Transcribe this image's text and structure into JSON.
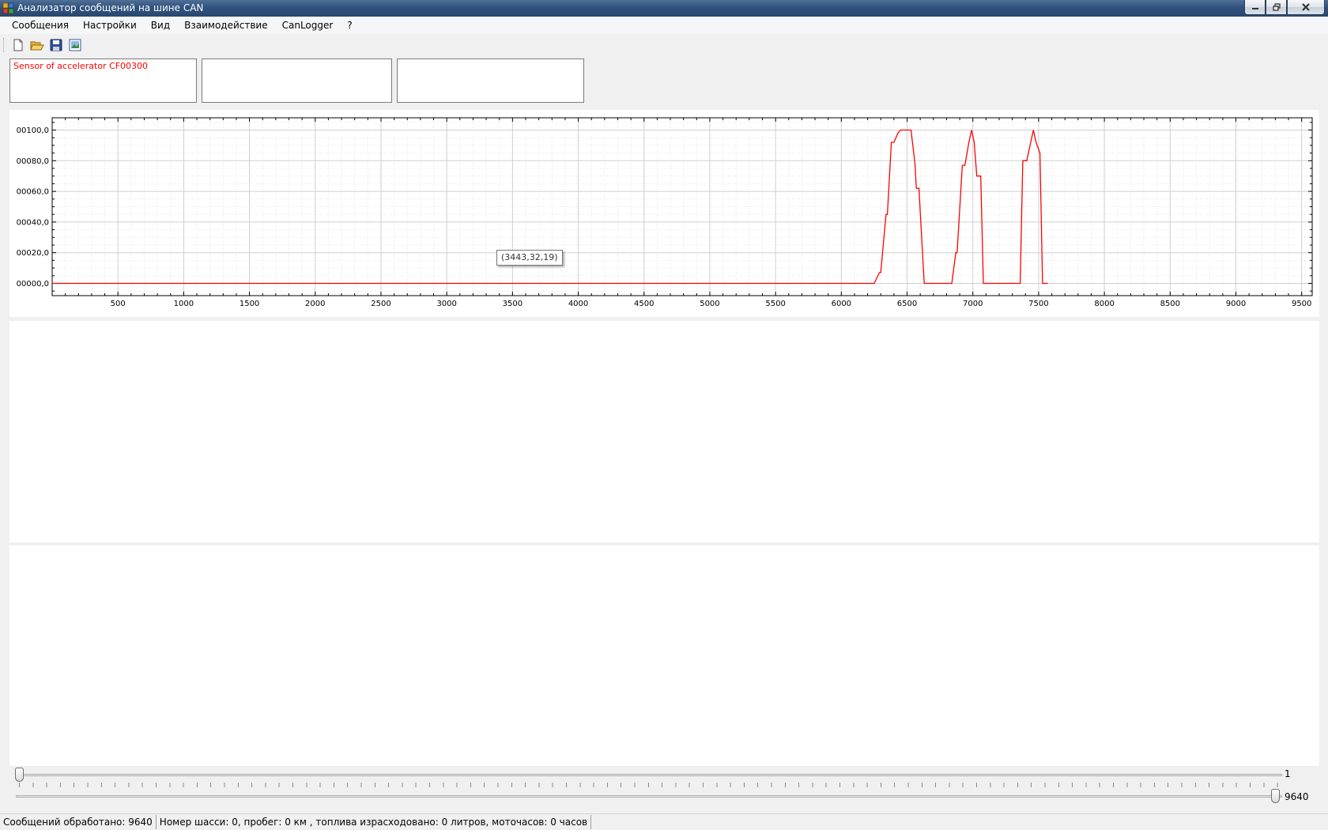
{
  "window": {
    "title": "Анализатор сообщений на шине CAN"
  },
  "menu": [
    "Сообщения",
    "Настройки",
    "Вид",
    "Взаимодействие",
    "CanLogger",
    "?"
  ],
  "toolbar": {
    "icons": [
      "new-file-icon",
      "open-folder-icon",
      "save-icon",
      "export-image-icon"
    ]
  },
  "message_boxes": [
    "Sensor of accelerator CF00300",
    "",
    ""
  ],
  "colors": {
    "signal": "#ff0000",
    "title_bar": "#2f527e",
    "close_button": "#c9463d"
  },
  "chart": {
    "tooltip": "(3443,32,19)"
  },
  "chart_data": {
    "type": "line",
    "series": [
      {
        "color": "#ff0000",
        "x": [
          1,
          6250,
          6290,
          6300,
          6340,
          6350,
          6380,
          6400,
          6430,
          6450,
          6490,
          6530,
          6560,
          6570,
          6590,
          6630,
          6640,
          6840,
          6870,
          6880,
          6920,
          6940,
          6970,
          6990,
          7010,
          7030,
          7060,
          7080,
          7100,
          7120,
          7360,
          7380,
          7410,
          7440,
          7460,
          7480,
          7510,
          7530,
          7550,
          7570
        ],
        "y": [
          0,
          0,
          7,
          7,
          45,
          45,
          92,
          92,
          98,
          100,
          100,
          100,
          78,
          62,
          62,
          0,
          0,
          0,
          20,
          20,
          77,
          77,
          92,
          100,
          92,
          70,
          70,
          0,
          0,
          0,
          0,
          80,
          80,
          92,
          100,
          92,
          85,
          0,
          0,
          0
        ]
      }
    ],
    "xlim": [
      0,
      9580
    ],
    "ylim": [
      -8,
      108
    ],
    "x_ticks": [
      500,
      1000,
      1500,
      2000,
      2500,
      3000,
      3500,
      4000,
      4500,
      5000,
      5500,
      6000,
      6500,
      7000,
      7500,
      8000,
      8500,
      9000,
      9500
    ],
    "y_ticks": [
      0,
      20,
      40,
      60,
      80,
      100
    ],
    "y_tick_labels": [
      "00000,0",
      "00020,0",
      "00040,0",
      "00060,0",
      "00080,0",
      "00100,0"
    ],
    "grid": true
  },
  "sliders": [
    {
      "value": 1,
      "max": 9640,
      "label": "1"
    },
    {
      "value": 9640,
      "max": 9640,
      "label": "9640"
    }
  ],
  "status": {
    "processed": "Сообщений обработано: 9640",
    "vehicle": "Номер шасси: 0, пробег: 0 км , топлива израсходовано: 0 литров, моточасов: 0 часов"
  }
}
